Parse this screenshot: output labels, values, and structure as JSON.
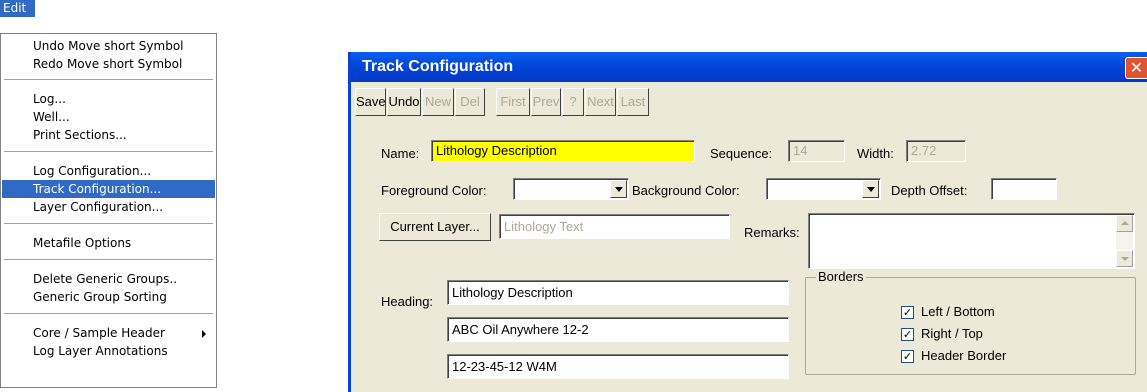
{
  "menu": {
    "title": "Edit",
    "items": [
      {
        "label": "Undo Move short Symbol"
      },
      {
        "label": "Redo Move short Symbol"
      },
      {
        "label": "Log..."
      },
      {
        "label": "Well..."
      },
      {
        "label": "Print Sections..."
      },
      {
        "label": "Log Configuration..."
      },
      {
        "label": "Track Configuration..."
      },
      {
        "label": "Layer Configuration..."
      },
      {
        "label": "Metafile Options"
      },
      {
        "label": "Delete Generic Groups.."
      },
      {
        "label": "Generic Group Sorting"
      },
      {
        "label": "Core / Sample Header"
      },
      {
        "label": "Log Layer Annotations"
      }
    ],
    "active_item": "Track Configuration..."
  },
  "dialog": {
    "title": "Track Configuration",
    "close_glyph": "✕",
    "toolbar": {
      "save": "Save",
      "undo": "Undo",
      "new": "New",
      "del": "Del",
      "first": "First",
      "prev": "Prev",
      "help": "?",
      "next": "Next",
      "last": "Last"
    },
    "name_label": "Name:",
    "name_value": "Lithology Description",
    "sequence_label": "Sequence:",
    "sequence_value": "14",
    "width_label": "Width:",
    "width_value": "2.72",
    "foreground_label": "Foreground Color:",
    "foreground_value": "",
    "background_label": "Background Color:",
    "background_value": "",
    "depth_offset_label": "Depth Offset:",
    "depth_offset_value": "",
    "current_layer_button": "Current Layer...",
    "current_layer_value": "Lithology Text",
    "remarks_label": "Remarks:",
    "remarks_value": "",
    "heading_label": "Heading:",
    "heading_lines": [
      "Lithology Description",
      "ABC Oil Anywhere 12-2",
      "12-23-45-12 W4M"
    ],
    "borders": {
      "title": "Borders",
      "options": [
        {
          "label": "Left / Bottom",
          "checked": true
        },
        {
          "label": "Right / Top",
          "checked": true
        },
        {
          "label": "Header Border",
          "checked": true
        }
      ]
    }
  },
  "colors": {
    "selection": "#316ac5",
    "titlebar": "#0447d8",
    "dialog_bg": "#ece9d8",
    "name_highlight": "#ffff00",
    "close_button": "#e0542f"
  }
}
